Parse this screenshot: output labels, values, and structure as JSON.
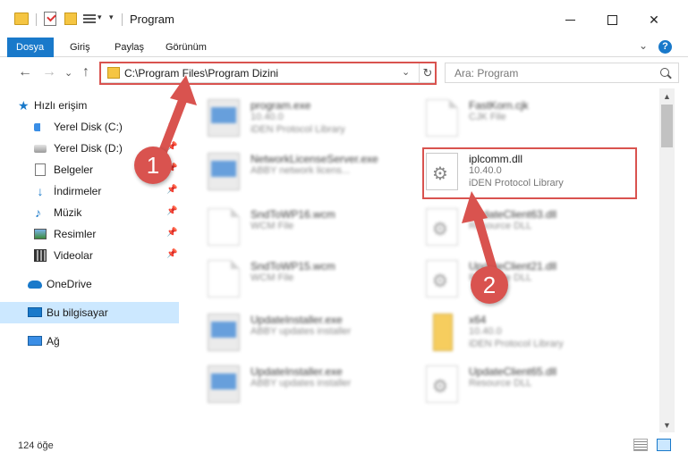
{
  "window": {
    "title": "Program",
    "minimize_glyph": "",
    "maximize_glyph": "",
    "close_glyph": "✕"
  },
  "ribbon": {
    "tabs": [
      {
        "label": "Dosya",
        "active": true
      },
      {
        "label": "Giriş"
      },
      {
        "label": "Paylaş"
      },
      {
        "label": "Görünüm"
      }
    ],
    "help_glyph": "?",
    "collapse_glyph": "⌄"
  },
  "nav": {
    "back_glyph": "←",
    "forward_glyph": "→",
    "recent_glyph": "⌄",
    "up_glyph": "↑",
    "address": "C:\\Program Files\\Program Dizini",
    "address_dropdown_glyph": "⌄",
    "refresh_glyph": "↻",
    "search_placeholder": "Ara: Program"
  },
  "sidebar": {
    "items": [
      {
        "label": "Hızlı erişim",
        "icon": "star-icon",
        "pinned": false
      },
      {
        "label": "Yerel Disk (C:)",
        "icon": "disk-c-icon",
        "pinned": true
      },
      {
        "label": "Yerel Disk (D:)",
        "icon": "disk-d-icon",
        "pinned": true
      },
      {
        "label": "Belgeler",
        "icon": "documents-icon",
        "pinned": true
      },
      {
        "label": "İndirmeler",
        "icon": "downloads-icon",
        "pinned": true
      },
      {
        "label": "Müzik",
        "icon": "music-icon",
        "pinned": true
      },
      {
        "label": "Resimler",
        "icon": "pictures-icon",
        "pinned": true
      },
      {
        "label": "Videolar",
        "icon": "videos-icon",
        "pinned": true
      },
      {
        "label": "OneDrive",
        "icon": "onedrive-icon",
        "pinned": false
      },
      {
        "label": "Bu bilgisayar",
        "icon": "this-pc-icon",
        "pinned": false,
        "selected": true
      },
      {
        "label": "Ağ",
        "icon": "network-icon",
        "pinned": false
      }
    ],
    "pin_glyph": "📌"
  },
  "files": [
    {
      "name": "program.exe",
      "type": "10.40.0",
      "desc": "iDEN Protocol Library",
      "icon": "exe-icon",
      "blurred": true
    },
    {
      "name": "FastKorn.cjk",
      "type": "CJK File",
      "desc": "",
      "icon": "document-icon",
      "blurred": true
    },
    {
      "name": "NetworkLicenseServer.exe",
      "type": "ABBY network licens...",
      "desc": "",
      "icon": "exe-icon",
      "blurred": true
    },
    {
      "name": "iplcomm.dll",
      "type": "10.40.0",
      "desc": "iDEN Protocol Library",
      "icon": "dll-icon",
      "blurred": false
    },
    {
      "name": "SndToWP16.wcm",
      "type": "WCM File",
      "desc": "",
      "icon": "document-icon",
      "blurred": true
    },
    {
      "name": "UpdateClient63.dll",
      "type": "Resource DLL",
      "desc": "",
      "icon": "dll-icon",
      "blurred": true
    },
    {
      "name": "SndToWP15.wcm",
      "type": "WCM File",
      "desc": "",
      "icon": "document-icon",
      "blurred": true
    },
    {
      "name": "UpdateClient21.dll",
      "type": "Resource DLL",
      "desc": "",
      "icon": "dll-icon",
      "blurred": true
    },
    {
      "name": "UpdateInstaller.exe",
      "type": "ABBY updates installer",
      "desc": "",
      "icon": "exe-icon",
      "blurred": true
    },
    {
      "name": "x64",
      "type": "10.40.0",
      "desc": "iDEN Protocol Library",
      "icon": "folder-icon",
      "blurred": true
    },
    {
      "name": "UpdateInstaller.exe",
      "type": "ABBY updates installer",
      "desc": "",
      "icon": "exe-icon",
      "blurred": true
    },
    {
      "name": "UpdateClient65.dll",
      "type": "Resource DLL",
      "desc": "",
      "icon": "dll-icon",
      "blurred": true
    }
  ],
  "scrollbar": {
    "up_glyph": "▲",
    "down_glyph": "▼"
  },
  "status": {
    "item_count": "124 öğe"
  },
  "annotations": {
    "marker_1": "1",
    "marker_2": "2",
    "color": "#d9534f"
  },
  "colors": {
    "accent": "#1979ca",
    "selection": "#cce8ff",
    "highlight": "#d9534f"
  }
}
